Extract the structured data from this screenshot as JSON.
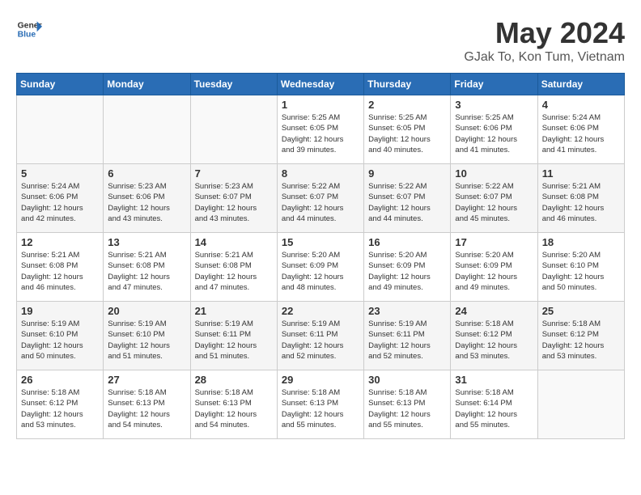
{
  "header": {
    "logo_line1": "General",
    "logo_line2": "Blue",
    "month": "May 2024",
    "location": "GJak To, Kon Tum, Vietnam"
  },
  "weekdays": [
    "Sunday",
    "Monday",
    "Tuesday",
    "Wednesday",
    "Thursday",
    "Friday",
    "Saturday"
  ],
  "weeks": [
    [
      {
        "day": "",
        "info": ""
      },
      {
        "day": "",
        "info": ""
      },
      {
        "day": "",
        "info": ""
      },
      {
        "day": "1",
        "info": "Sunrise: 5:25 AM\nSunset: 6:05 PM\nDaylight: 12 hours\nand 39 minutes."
      },
      {
        "day": "2",
        "info": "Sunrise: 5:25 AM\nSunset: 6:05 PM\nDaylight: 12 hours\nand 40 minutes."
      },
      {
        "day": "3",
        "info": "Sunrise: 5:25 AM\nSunset: 6:06 PM\nDaylight: 12 hours\nand 41 minutes."
      },
      {
        "day": "4",
        "info": "Sunrise: 5:24 AM\nSunset: 6:06 PM\nDaylight: 12 hours\nand 41 minutes."
      }
    ],
    [
      {
        "day": "5",
        "info": "Sunrise: 5:24 AM\nSunset: 6:06 PM\nDaylight: 12 hours\nand 42 minutes."
      },
      {
        "day": "6",
        "info": "Sunrise: 5:23 AM\nSunset: 6:06 PM\nDaylight: 12 hours\nand 43 minutes."
      },
      {
        "day": "7",
        "info": "Sunrise: 5:23 AM\nSunset: 6:07 PM\nDaylight: 12 hours\nand 43 minutes."
      },
      {
        "day": "8",
        "info": "Sunrise: 5:22 AM\nSunset: 6:07 PM\nDaylight: 12 hours\nand 44 minutes."
      },
      {
        "day": "9",
        "info": "Sunrise: 5:22 AM\nSunset: 6:07 PM\nDaylight: 12 hours\nand 44 minutes."
      },
      {
        "day": "10",
        "info": "Sunrise: 5:22 AM\nSunset: 6:07 PM\nDaylight: 12 hours\nand 45 minutes."
      },
      {
        "day": "11",
        "info": "Sunrise: 5:21 AM\nSunset: 6:08 PM\nDaylight: 12 hours\nand 46 minutes."
      }
    ],
    [
      {
        "day": "12",
        "info": "Sunrise: 5:21 AM\nSunset: 6:08 PM\nDaylight: 12 hours\nand 46 minutes."
      },
      {
        "day": "13",
        "info": "Sunrise: 5:21 AM\nSunset: 6:08 PM\nDaylight: 12 hours\nand 47 minutes."
      },
      {
        "day": "14",
        "info": "Sunrise: 5:21 AM\nSunset: 6:08 PM\nDaylight: 12 hours\nand 47 minutes."
      },
      {
        "day": "15",
        "info": "Sunrise: 5:20 AM\nSunset: 6:09 PM\nDaylight: 12 hours\nand 48 minutes."
      },
      {
        "day": "16",
        "info": "Sunrise: 5:20 AM\nSunset: 6:09 PM\nDaylight: 12 hours\nand 49 minutes."
      },
      {
        "day": "17",
        "info": "Sunrise: 5:20 AM\nSunset: 6:09 PM\nDaylight: 12 hours\nand 49 minutes."
      },
      {
        "day": "18",
        "info": "Sunrise: 5:20 AM\nSunset: 6:10 PM\nDaylight: 12 hours\nand 50 minutes."
      }
    ],
    [
      {
        "day": "19",
        "info": "Sunrise: 5:19 AM\nSunset: 6:10 PM\nDaylight: 12 hours\nand 50 minutes."
      },
      {
        "day": "20",
        "info": "Sunrise: 5:19 AM\nSunset: 6:10 PM\nDaylight: 12 hours\nand 51 minutes."
      },
      {
        "day": "21",
        "info": "Sunrise: 5:19 AM\nSunset: 6:11 PM\nDaylight: 12 hours\nand 51 minutes."
      },
      {
        "day": "22",
        "info": "Sunrise: 5:19 AM\nSunset: 6:11 PM\nDaylight: 12 hours\nand 52 minutes."
      },
      {
        "day": "23",
        "info": "Sunrise: 5:19 AM\nSunset: 6:11 PM\nDaylight: 12 hours\nand 52 minutes."
      },
      {
        "day": "24",
        "info": "Sunrise: 5:18 AM\nSunset: 6:12 PM\nDaylight: 12 hours\nand 53 minutes."
      },
      {
        "day": "25",
        "info": "Sunrise: 5:18 AM\nSunset: 6:12 PM\nDaylight: 12 hours\nand 53 minutes."
      }
    ],
    [
      {
        "day": "26",
        "info": "Sunrise: 5:18 AM\nSunset: 6:12 PM\nDaylight: 12 hours\nand 53 minutes."
      },
      {
        "day": "27",
        "info": "Sunrise: 5:18 AM\nSunset: 6:13 PM\nDaylight: 12 hours\nand 54 minutes."
      },
      {
        "day": "28",
        "info": "Sunrise: 5:18 AM\nSunset: 6:13 PM\nDaylight: 12 hours\nand 54 minutes."
      },
      {
        "day": "29",
        "info": "Sunrise: 5:18 AM\nSunset: 6:13 PM\nDaylight: 12 hours\nand 55 minutes."
      },
      {
        "day": "30",
        "info": "Sunrise: 5:18 AM\nSunset: 6:13 PM\nDaylight: 12 hours\nand 55 minutes."
      },
      {
        "day": "31",
        "info": "Sunrise: 5:18 AM\nSunset: 6:14 PM\nDaylight: 12 hours\nand 55 minutes."
      },
      {
        "day": "",
        "info": ""
      }
    ]
  ]
}
